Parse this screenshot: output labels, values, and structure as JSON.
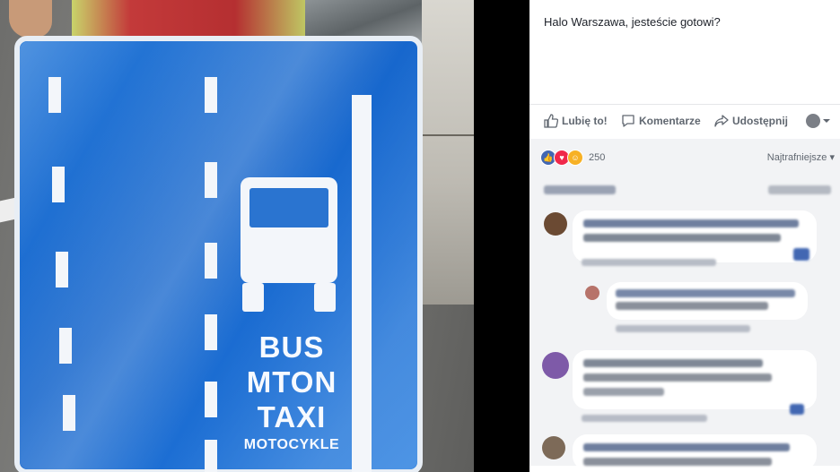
{
  "post": {
    "text": "Halo Warszawa, jesteście gotowi?"
  },
  "sign": {
    "line1": "BUS",
    "line2": "MTON",
    "line3": "TAXI",
    "line4": "MOTOCYKLE"
  },
  "actions": {
    "like": "Lubię to!",
    "comment": "Komentarze",
    "share": "Udostępnij"
  },
  "reactions": {
    "count": "250",
    "sort_label": "Najtrafniejsze"
  },
  "colors": {
    "sign_blue": "#1666cc",
    "fb_blue": "#4267b2",
    "love_red": "#f0284a",
    "haha_yellow": "#f7b125"
  }
}
